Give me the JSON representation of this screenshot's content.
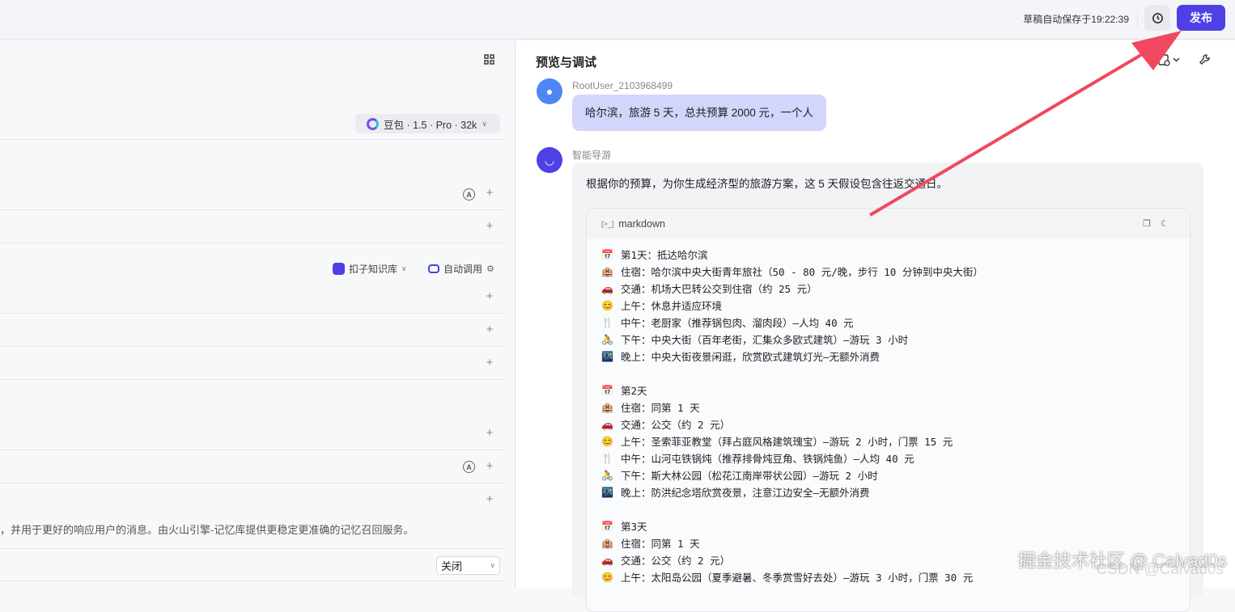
{
  "topbar": {
    "saved_text": "草稿自动保存于19:22:39",
    "publish_label": "发布"
  },
  "left": {
    "model_label": "豆包 · 1.5 · Pro · 32k",
    "knowledge_label": "扣子知识库",
    "auto_call_label": "自动调用",
    "memory_desc": "，并用于更好的响应用户的消息。由火山引擎-记忆库提供更稳定更准确的记忆召回服务。",
    "select_value": "关闭"
  },
  "preview": {
    "title": "预览与调试",
    "user": {
      "name": "RootUser_2103968499",
      "message": "哈尔滨，旅游 5 天，总共预算 2000 元，一个人"
    },
    "bot": {
      "name": "智能导游",
      "intro": "根据你的预算，为你生成经济型的旅游方案，这 5 天假设包含往返交通日。",
      "code_lang": "markdown",
      "lines": [
        {
          "icon": "calendar",
          "text": "第1天：抵达哈尔滨"
        },
        {
          "icon": "hotel",
          "text": "住宿：哈尔滨中央大街青年旅社（50 - 80 元/晚，步行 10 分钟到中央大街）"
        },
        {
          "icon": "car",
          "text": "交通：机场大巴转公交到住宿（约 25 元）"
        },
        {
          "icon": "sun",
          "text": "上午：休息并适应环境"
        },
        {
          "icon": "fork",
          "text": "中午：老厨家（推荐锅包肉、溜肉段）—人均 40 元"
        },
        {
          "icon": "bike",
          "text": "下午：中央大街（百年老街，汇集众多欧式建筑）—游玩 3 小时"
        },
        {
          "icon": "night",
          "text": "晚上：中央大街夜景闲逛，欣赏欧式建筑灯光—无额外消费"
        },
        {
          "icon": "",
          "text": ""
        },
        {
          "icon": "calendar",
          "text": "第2天"
        },
        {
          "icon": "hotel",
          "text": "住宿：同第 1 天"
        },
        {
          "icon": "car",
          "text": "交通：公交（约 2 元）"
        },
        {
          "icon": "sun",
          "text": "上午：圣索菲亚教堂（拜占庭风格建筑瑰宝）—游玩 2 小时，门票 15 元"
        },
        {
          "icon": "fork",
          "text": "中午：山河屯铁锅炖（推荐排骨炖豆角、铁锅炖鱼）—人均 40 元"
        },
        {
          "icon": "bike",
          "text": "下午：斯大林公园（松花江南岸带状公园）—游玩 2 小时"
        },
        {
          "icon": "night",
          "text": "晚上：防洪纪念塔欣赏夜景，注意江边安全—无额外消费"
        },
        {
          "icon": "",
          "text": ""
        },
        {
          "icon": "calendar",
          "text": "第3天"
        },
        {
          "icon": "hotel",
          "text": "住宿：同第 1 天"
        },
        {
          "icon": "car",
          "text": "交通：公交（约 2 元）"
        },
        {
          "icon": "sun",
          "text": "上午：太阳岛公园（夏季避暑、冬季赏雪好去处）—游玩 3 小时，门票 30 元"
        }
      ]
    }
  },
  "watermark": {
    "text": "掘金技术社区 @ Calvad0s",
    "csdn": "CSDN @Calvad0s"
  },
  "colors": {
    "accent": "#4e40e5",
    "user_bubble": "#d3d5fb",
    "arrow": "#f0485e"
  }
}
